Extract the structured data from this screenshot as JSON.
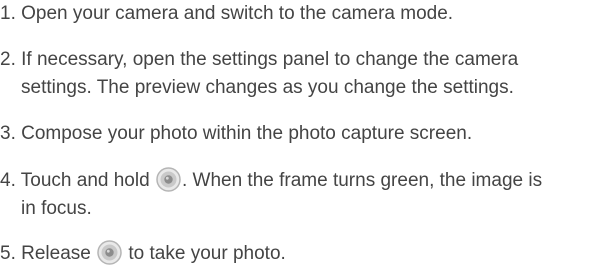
{
  "steps": [
    {
      "line1": "1. Open your camera and switch to the camera mode."
    },
    {
      "line1": "2. If necessary, open the settings panel to change the camera",
      "line2": "settings. The preview changes as you change the settings."
    },
    {
      "line1": "3. Compose your photo within the photo capture screen."
    },
    {
      "before_icon": "4. Touch and hold",
      "after_icon": ". When the frame turns green, the image is",
      "line2": "in focus.",
      "icon": "shutter-button-icon"
    },
    {
      "before_icon": "5. Release",
      "after_icon": "to take your photo.",
      "icon": "shutter-button-icon"
    }
  ],
  "colors": {
    "text": "#444444",
    "shutter_outer": "#b5b5b5",
    "shutter_inner": "#8c8c8c"
  }
}
